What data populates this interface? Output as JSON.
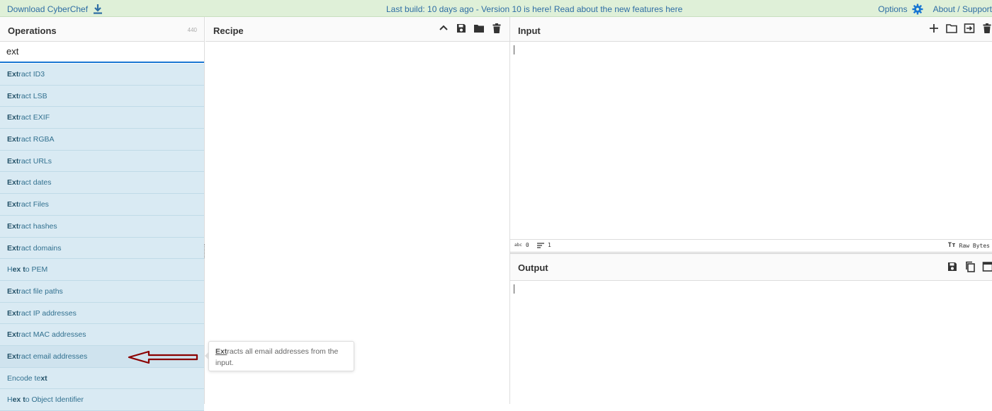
{
  "banner": {
    "download_label": "Download CyberChef",
    "build_text": "Last build: 10 days ago - Version 10 is here! Read about the new features here",
    "options_label": "Options",
    "about_label": "About / Support"
  },
  "operations": {
    "title": "Operations",
    "count": "440",
    "search_value": "ext",
    "items": [
      {
        "pre": "",
        "hl": "Ext",
        "post": "ract ID3"
      },
      {
        "pre": "",
        "hl": "Ext",
        "post": "ract LSB"
      },
      {
        "pre": "",
        "hl": "Ext",
        "post": "ract EXIF"
      },
      {
        "pre": "",
        "hl": "Ext",
        "post": "ract RGBA"
      },
      {
        "pre": "",
        "hl": "Ext",
        "post": "ract URLs"
      },
      {
        "pre": "",
        "hl": "Ext",
        "post": "ract dates"
      },
      {
        "pre": "",
        "hl": "Ext",
        "post": "ract Files"
      },
      {
        "pre": "",
        "hl": "Ext",
        "post": "ract hashes"
      },
      {
        "pre": "",
        "hl": "Ext",
        "post": "ract domains"
      },
      {
        "pre": "H",
        "hl": "ex t",
        "post": "o PEM"
      },
      {
        "pre": "",
        "hl": "Ext",
        "post": "ract file paths"
      },
      {
        "pre": "",
        "hl": "Ext",
        "post": "ract IP addresses"
      },
      {
        "pre": "",
        "hl": "Ext",
        "post": "ract MAC addresses"
      },
      {
        "pre": "",
        "hl": "Ext",
        "post": "ract email addresses"
      },
      {
        "pre": "E",
        "hl": "",
        "post": "ncode te",
        "hl2": "xt"
      },
      {
        "pre": "H",
        "hl": "ex t",
        "post": "o Object Identifier"
      }
    ]
  },
  "recipe": {
    "title": "Recipe"
  },
  "input": {
    "title": "Input",
    "length": "0",
    "lines": "1",
    "raw_bytes_label": "Raw Bytes"
  },
  "output": {
    "title": "Output"
  },
  "tooltip": {
    "hl": "Ext",
    "text": "racts all email addresses from the input."
  },
  "colors": {
    "banner_bg": "#dff0d8",
    "op_item_bg": "#d9eaf3",
    "link": "#2e6da4",
    "arrow": "#8b0000"
  }
}
